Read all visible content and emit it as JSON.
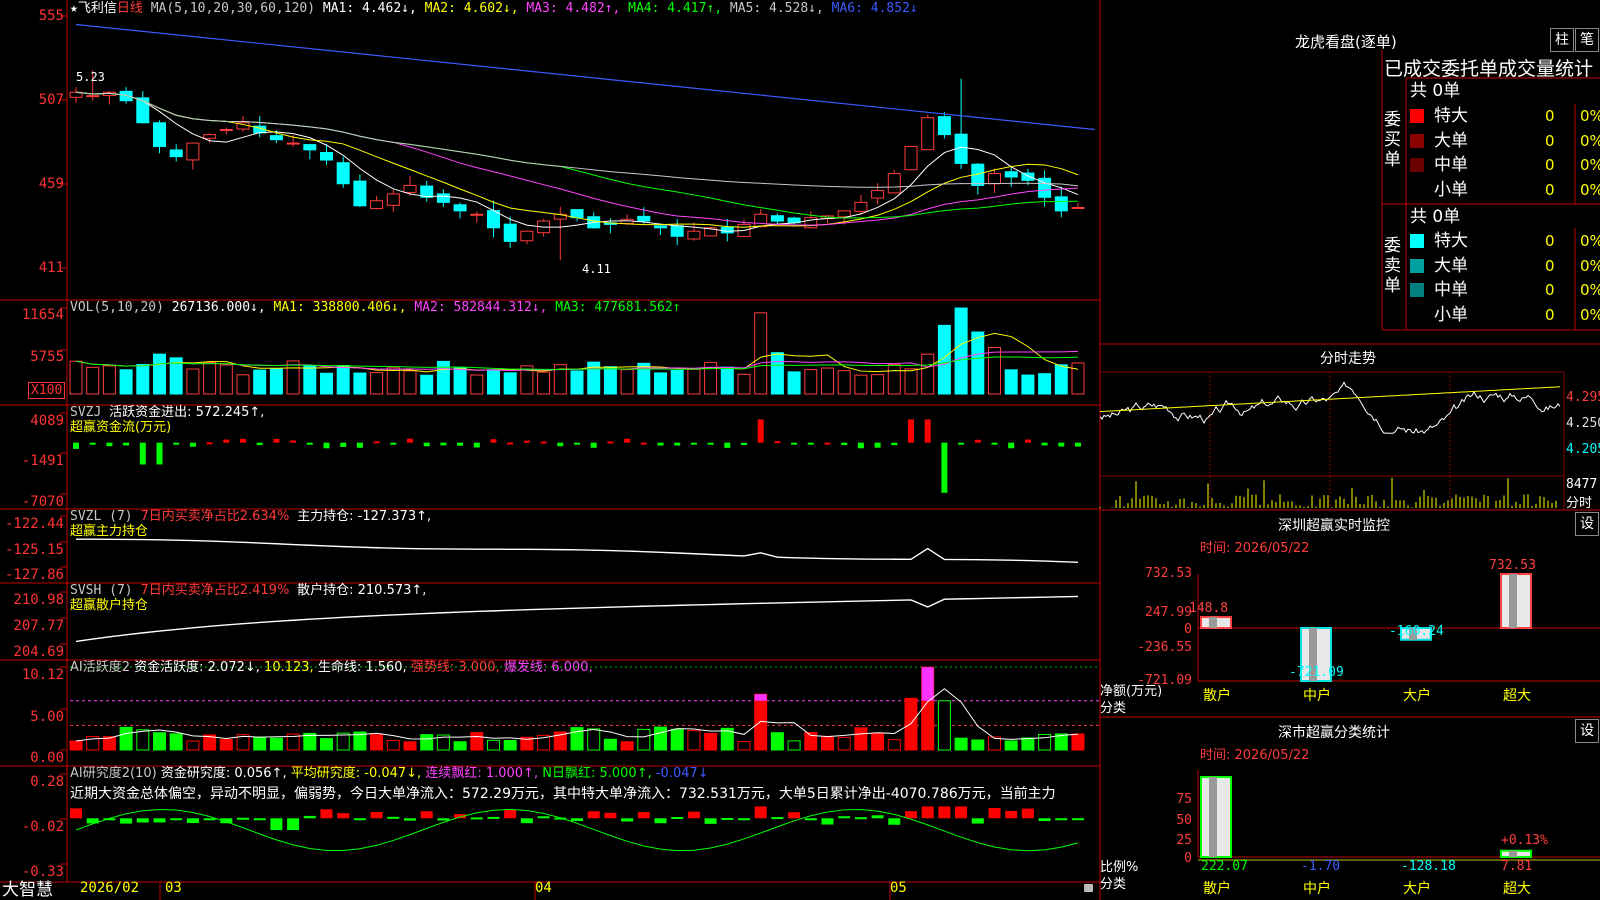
{
  "stock": {
    "star": "★",
    "name": "飞利信",
    "period": "日线"
  },
  "kline_header": {
    "ma_params": "MA(5,10,20,30,60,120)",
    "ma1": "MA1: 4.462↓,",
    "ma2": "MA2: 4.602↓,",
    "ma3": "MA3: 4.482↑,",
    "ma4": "MA4: 4.417↑,",
    "ma5": "MA5: 4.528↓,",
    "ma6": "MA6: 4.852↓"
  },
  "kline_axis": [
    "555",
    "507",
    "459",
    "411"
  ],
  "kline_marks": {
    "high": "5.23",
    "low": "4.11"
  },
  "vol": {
    "params": "VOL(5,10,20)",
    "value": "267136.000↓,",
    "ma1": "MA1: 338800.406↓,",
    "ma2": "MA2: 582844.312↓,",
    "ma3": "MA3: 477681.562↑",
    "axis": [
      "11654",
      "5755",
      "X100"
    ]
  },
  "svzj": {
    "name": "SVZJ",
    "label": "活跃资金进出: 572.245↑,",
    "sub": "超赢资金流(万元)",
    "axis": [
      "4089",
      "-1491",
      "-7070"
    ]
  },
  "svzl": {
    "name": "SVZL (7)",
    "ratio": "7日内买卖净占比2.634%",
    "label": "主力持仓: -127.373↑,",
    "sub": "超赢主力持仓",
    "axis": [
      "-122.44",
      "-125.15",
      "-127.86"
    ]
  },
  "svsh": {
    "name": "SVSH (7)",
    "ratio": "7日内买卖净占比2.419%",
    "label": "散户持仓: 210.573↑,",
    "sub": "超赢散户持仓",
    "axis": [
      "210.98",
      "207.77",
      "204.69"
    ]
  },
  "ai_active": {
    "name": "AI活跃度2",
    "a": "资金活跃度: 2.072↓,",
    "b": "10.123,",
    "c": "生命线: 1.560,",
    "d": "强势线: 3.000,",
    "e": "爆发线: 6.000,",
    "axis": [
      "10.12",
      "5.00",
      "0.00"
    ]
  },
  "ai_research": {
    "name": "AI研究度2(10)",
    "a": "资金研究度: 0.056↑,",
    "b": "平均研究度: -0.047↓,",
    "c": "连续飘红: 1.000↑,",
    "d": "N日飘红: 5.000↑,",
    "e": "-0.047↓",
    "comment": "近期大资金总体偏空，异动不明显，偏弱势，今日大单净流入：572.29万元，其中特大单净流入：732.531万元，大单5日累计净出-4070.786万元，当前主力",
    "axis": [
      "0.28",
      "-0.02",
      "-0.33"
    ]
  },
  "x_axis": {
    "brand": "大智慧",
    "labels": [
      "2026/02",
      "03",
      "04",
      "05"
    ]
  },
  "dragon": {
    "title": "龙虎看盘(逐单)",
    "btn1": "柱",
    "btn2": "笔",
    "stats_title": "已成交委托单成交量统计",
    "buy_side": "委买单",
    "sell_side": "委卖单",
    "buy_total": "共 0单",
    "sell_total": "共 0单",
    "buy_rows": [
      {
        "label": "特大",
        "count": "0",
        "pct": "0%",
        "color": "#ff0000"
      },
      {
        "label": "大单",
        "count": "0",
        "pct": "0%",
        "color": "#8b0000"
      },
      {
        "label": "中单",
        "count": "0",
        "pct": "0%",
        "color": "#6b0000"
      },
      {
        "label": "小单",
        "count": "0",
        "pct": "0%",
        "color": ""
      }
    ],
    "sell_rows": [
      {
        "label": "特大",
        "count": "0",
        "pct": "0%",
        "color": "#00ffff"
      },
      {
        "label": "大单",
        "count": "0",
        "pct": "0%",
        "color": "#00a0a0"
      },
      {
        "label": "中单",
        "count": "0",
        "pct": "0%",
        "color": "#008080"
      },
      {
        "label": "小单",
        "count": "0",
        "pct": "0%",
        "color": ""
      }
    ]
  },
  "intraday": {
    "title": "分时走势",
    "axis": [
      "4.295",
      "4.250",
      "4.205"
    ],
    "vol_top": "8477",
    "vol_label": "分时"
  },
  "monitor": {
    "title": "深圳超赢实时监控",
    "btn": "设",
    "time": "时间: 2026/05/22",
    "axis": [
      "732.53",
      "247.99",
      "0",
      "-236.55",
      "-721.09"
    ],
    "unit": "净额(万元)",
    "cat_label": "分类",
    "bars": [
      {
        "cat": "散户",
        "value": 148.8,
        "label": "148.8"
      },
      {
        "cat": "中户",
        "value": -721.09,
        "label": "-721.09"
      },
      {
        "cat": "大户",
        "value": -160.24,
        "label": "-160.24"
      },
      {
        "cat": "超大",
        "value": 732.53,
        "label": "732.53"
      }
    ]
  },
  "classify": {
    "title": "深市超赢分类统计",
    "btn": "设",
    "time": "时间: 2026/05/22",
    "axis": [
      "75",
      "50",
      "25",
      "0"
    ],
    "unit": "比例%",
    "cat_label": "分类",
    "bars": [
      {
        "cat": "散户",
        "value": 222.07,
        "label": "222.07"
      },
      {
        "cat": "中户",
        "value": -1.7,
        "label": "-1.70"
      },
      {
        "cat": "大户",
        "value": -128.18,
        "label": "-128.18"
      },
      {
        "cat": "超大",
        "value": 7.81,
        "label": "7.81",
        "extra": "+0.13%"
      }
    ]
  }
}
